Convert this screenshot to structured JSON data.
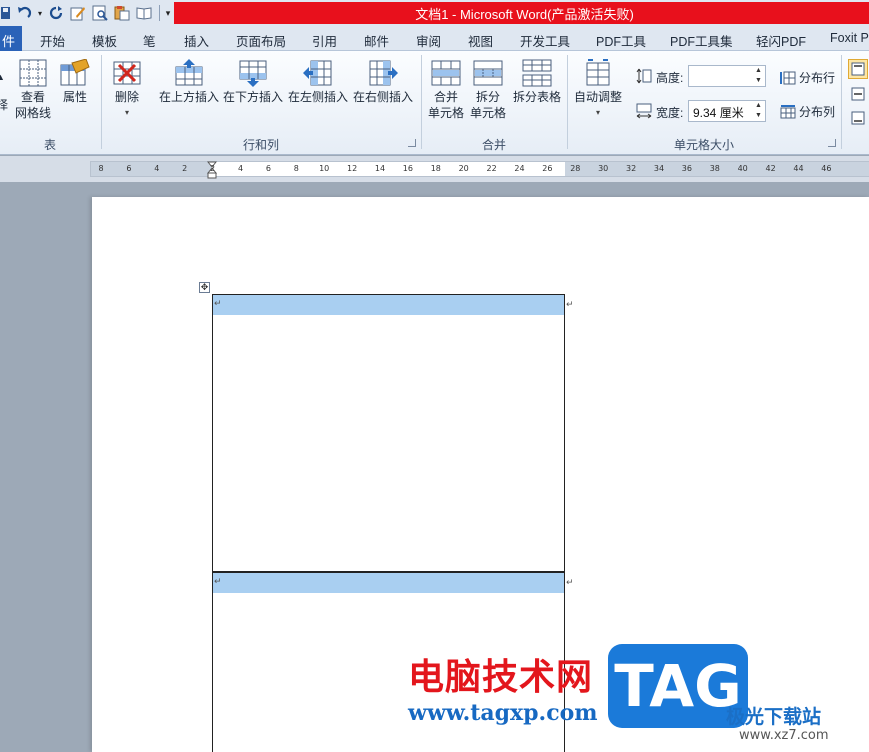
{
  "window": {
    "title": "文档1 - Microsoft Word(产品激活失败)"
  },
  "quick_access": [
    "save-icon",
    "undo-icon",
    "redo-icon",
    "edit-icon",
    "print-preview-icon",
    "paste-icon",
    "book-icon",
    "customize-icon"
  ],
  "tabs": {
    "file": "件",
    "items": [
      "开始",
      "模板",
      "笔",
      "插入",
      "页面布局",
      "引用",
      "邮件",
      "审阅",
      "视图",
      "开发工具",
      "PDF工具",
      "PDF工具集",
      "轻闪PDF",
      "Foxit P"
    ]
  },
  "ribbon": {
    "table_group": {
      "label": "表",
      "view_gridlines": [
        "查看",
        "网格线"
      ],
      "properties": "属性"
    },
    "rows_cols_group": {
      "label": "行和列",
      "delete": "删除",
      "insert_above": "在上方插入",
      "insert_below": "在下方插入",
      "insert_left": "在左侧插入",
      "insert_right": "在右侧插入"
    },
    "merge_group": {
      "label": "合并",
      "merge_cells": [
        "合并",
        "单元格"
      ],
      "split_cells": [
        "拆分",
        "单元格"
      ],
      "split_table": "拆分表格"
    },
    "cell_size_group": {
      "label": "单元格大小",
      "autofit": "自动调整",
      "height_label": "高度:",
      "height_value": "",
      "width_label": "宽度:",
      "width_value": "9.34 厘米",
      "distribute_rows": "分布行",
      "distribute_cols": "分布列"
    }
  },
  "ruler": {
    "ticks": [
      "8",
      "6",
      "4",
      "2",
      "2",
      "4",
      "6",
      "8",
      "10",
      "12",
      "14",
      "16",
      "18",
      "20",
      "22",
      "24",
      "26",
      "28",
      "30",
      "32",
      "34",
      "36",
      "38",
      "40",
      "42",
      "44",
      "46"
    ]
  },
  "document": {
    "paragraph_mark": "↵",
    "move_handle": "✥"
  },
  "watermark": {
    "site_cn": "电脑技术网",
    "site_url": "www.tagxp.com",
    "logo": "TAG",
    "brand_cn": "极光下载站",
    "brand_url": "www.xz7.com"
  }
}
